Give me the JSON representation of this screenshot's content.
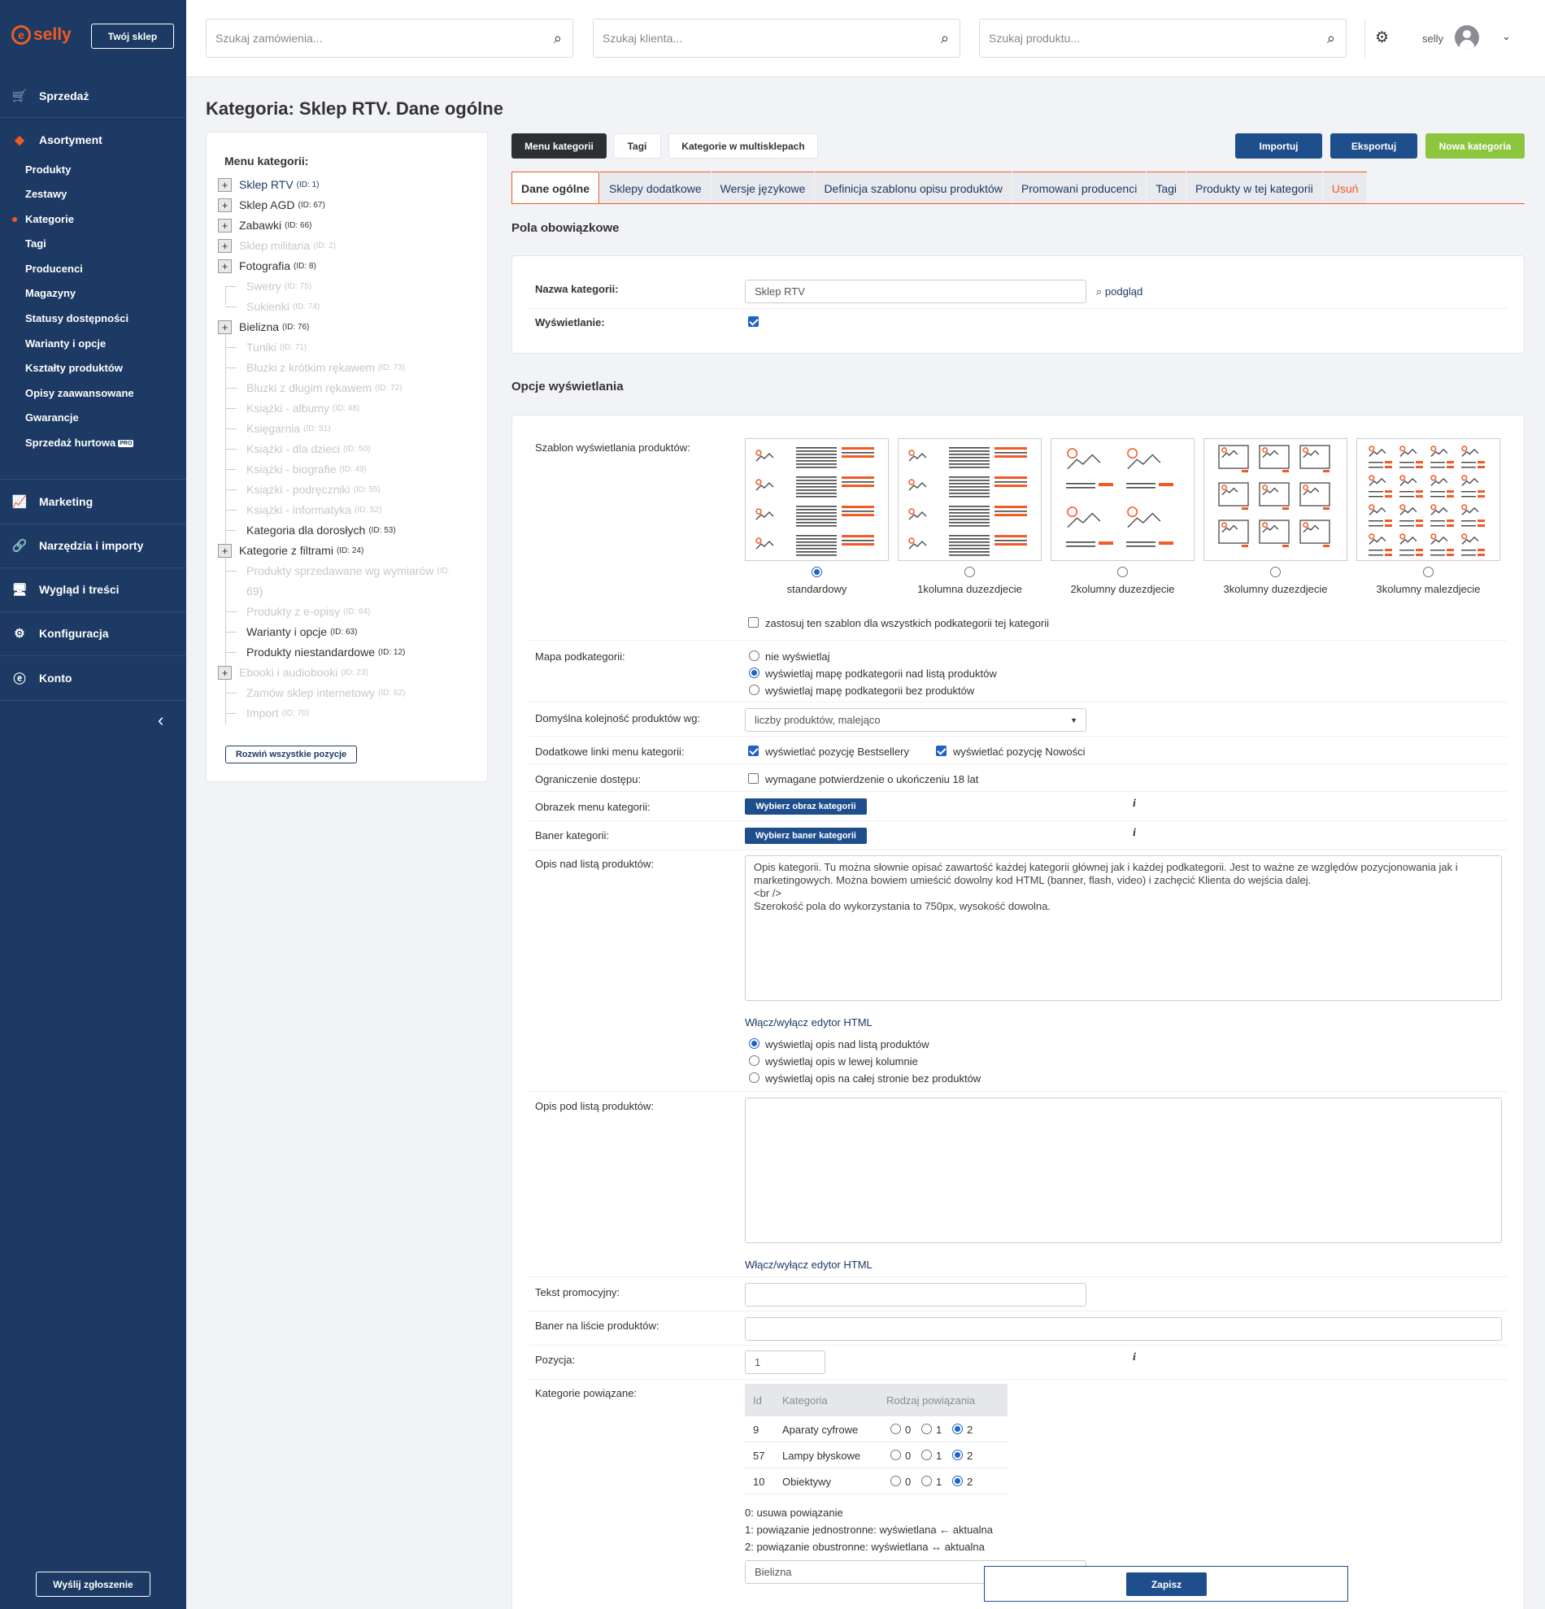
{
  "brand": {
    "logo": "selly",
    "shop_button": "Twój sklep"
  },
  "sidebar": {
    "main": [
      {
        "label": "Sprzedaż",
        "icon": "cart-icon"
      },
      {
        "label": "Asortyment",
        "icon": "tag-icon"
      },
      {
        "label": "Marketing",
        "icon": "chart-icon"
      },
      {
        "label": "Narzędzia i importy",
        "icon": "link-icon"
      },
      {
        "label": "Wygląd i treści",
        "icon": "monitor-icon"
      },
      {
        "label": "Konfiguracja",
        "icon": "gear-icon"
      },
      {
        "label": "Konto",
        "icon": "account-icon"
      }
    ],
    "sub": [
      "Produkty",
      "Zestawy",
      "Kategorie",
      "Tagi",
      "Producenci",
      "Magazyny",
      "Statusy dostępności",
      "Warianty i opcje",
      "Kształty produktów",
      "Opisy zaawansowane",
      "Gwarancje",
      "Sprzedaż hurtowa"
    ],
    "pro_badge": "PRO",
    "report_button": "Wyślij zgłoszenie"
  },
  "header": {
    "search_orders": "Szukaj zamówienia...",
    "search_clients": "Szukaj klienta...",
    "search_products": "Szukaj produktu...",
    "user": "selly"
  },
  "page": {
    "title": "Kategoria: Sklep RTV. Dane ogólne"
  },
  "tree": {
    "title": "Menu kategorii:",
    "items": [
      {
        "name": "Sklep RTV",
        "id": "(ID: 1)"
      },
      {
        "name": "Sklep AGD",
        "id": "(ID: 67)"
      },
      {
        "name": "Zabawki",
        "id": "(ID: 66)"
      },
      {
        "name": "Sklep militaria",
        "id": "(ID: 2)"
      },
      {
        "name": "Fotografia",
        "id": "(ID: 8)"
      },
      {
        "name": "Swetry",
        "id": "(ID: 75)"
      },
      {
        "name": "Sukienki",
        "id": "(ID: 74)"
      },
      {
        "name": "Bielizna",
        "id": "(ID: 76)"
      },
      {
        "name": "Tuniki",
        "id": "(ID: 71)"
      },
      {
        "name": "Bluzki z krótkim rękawem",
        "id": "(ID: 73)"
      },
      {
        "name": "Bluzki z długim rękawem",
        "id": "(ID: 72)"
      },
      {
        "name": "Książki - albumy",
        "id": "(ID: 48)"
      },
      {
        "name": "Księgarnia",
        "id": "(ID: 51)"
      },
      {
        "name": "Książki - dla dzieci",
        "id": "(ID: 50)"
      },
      {
        "name": "Książki - biografie",
        "id": "(ID: 49)"
      },
      {
        "name": "Książki - podręczniki",
        "id": "(ID: 55)"
      },
      {
        "name": "Książki - informatyka",
        "id": "(ID: 52)"
      },
      {
        "name": "Kategoria dla dorosłych",
        "id": "(ID: 53)"
      },
      {
        "name": "Kategorie z filtrami",
        "id": "(ID: 24)"
      },
      {
        "name": "Produkty sprzedawane wg wymiarów",
        "id": "(ID:"
      },
      {
        "name": "69)",
        "id": ""
      },
      {
        "name": "Produkty z e-opisy",
        "id": "(ID: 64)"
      },
      {
        "name": "Warianty i opcje",
        "id": "(ID: 63)"
      },
      {
        "name": "Produkty niestandardowe",
        "id": "(ID: 12)"
      },
      {
        "name": "Ebooki i audiobooki",
        "id": "(ID: 23)"
      },
      {
        "name": "Zamów sklep internetowy",
        "id": "(ID: 62)"
      },
      {
        "name": "Import",
        "id": "(ID: 70)"
      }
    ],
    "expand_button": "Rozwiń wszystkie pozycje"
  },
  "top_buttons": {
    "menu": "Menu kategorii",
    "tags": "Tagi",
    "multi": "Kategorie w multisklepach",
    "import": "Importuj",
    "export": "Eksportuj",
    "new": "Nowa kategoria"
  },
  "tabs": [
    "Dane ogólne",
    "Sklepy dodatkowe",
    "Wersje językowe",
    "Definicja szablonu opisu produktów",
    "Promowani producenci",
    "Tagi",
    "Produkty w tej kategorii",
    "Usuń"
  ],
  "required": {
    "title": "Pola obowiązkowe",
    "name_label": "Nazwa kategorii:",
    "name_value": "Sklep RTV",
    "preview": "podgląd",
    "display_label": "Wyświetlanie:"
  },
  "options": {
    "title": "Opcje wyświetlania",
    "template_label": "Szablon wyświetlania produktów:",
    "templates": [
      "standardowy",
      "1kolumna duzezdjecie",
      "2kolumny duzezdjecie",
      "3kolumny duzezdjecie",
      "3kolumny malezdjecie"
    ],
    "apply_all": "zastosuj ten szablon dla wszystkich podkategorii tej kategorii",
    "map_label": "Mapa podkategorii:",
    "map_options": [
      "nie wyświetlaj",
      "wyświetlaj mapę podkategorii nad listą produktów",
      "wyświetlaj mapę podkategorii bez produktów"
    ],
    "order_label": "Domyślna kolejność produktów wg:",
    "order_value": "liczby produktów, malejąco",
    "links_label": "Dodatkowe linki menu kategorii:",
    "links_best": "wyświetlać pozycję Bestsellery",
    "links_new": "wyświetlać pozycję Nowości",
    "access_label": "Ograniczenie dostępu:",
    "access_text": "wymagane potwierdzenie o ukończeniu 18 lat",
    "image_label": "Obrazek menu kategorii:",
    "image_button": "Wybierz obraz kategorii",
    "banner_label": "Baner kategorii:",
    "banner_button": "Wybierz baner kategorii",
    "info": "i",
    "desc_above_label": "Opis nad listą produktów:",
    "desc_above_text": "Opis kategorii. Tu można słownie opisać zawartość każdej kategorii głównej jak i każdej podkategorii. Jest to ważne ze względów pozycjonowania jak i marketingowych. Można bowiem umieścić dowolny kod HTML (banner, flash, video) i zachęcić Klienta do wejścia dalej.\n<br />\nSzerokość pola do wykorzystania to 750px, wysokość dowolna.",
    "toggle_editor": "Włącz/wyłącz edytor HTML",
    "desc_options": [
      "wyświetlaj opis nad listą produktów",
      "wyświetlaj opis w lewej kolumnie",
      "wyświetlaj opis na całej stronie bez produktów"
    ],
    "desc_below_label": "Opis pod listą produktów:",
    "promo_label": "Tekst promocyjny:",
    "banner_list_label": "Baner na liście produktów:",
    "position_label": "Pozycja:",
    "position_value": "1",
    "related_label": "Kategorie powiązane:",
    "related_head": [
      "Id",
      "Kategoria",
      "Rodzaj powiązania"
    ],
    "related_rows": [
      {
        "id": "9",
        "name": "Aparaty cyfrowe"
      },
      {
        "id": "57",
        "name": "Lampy błyskowe"
      },
      {
        "id": "10",
        "name": "Obiektywy"
      }
    ],
    "radio_values": [
      "0",
      "1",
      "2"
    ],
    "legend": [
      "0: usuwa powiązanie",
      "1: powiązanie jednostronne: wyświetlana ← aktualna",
      "2: powiązanie obustronne: wyświetlana ↔ aktualna"
    ],
    "related_input": "Bielizna"
  },
  "save_button": "Zapisz"
}
